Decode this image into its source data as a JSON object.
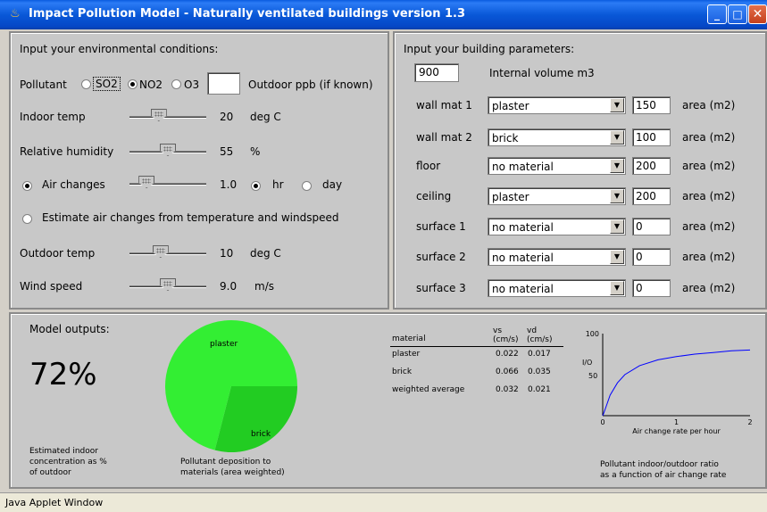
{
  "window": {
    "title": "Impact Pollution Model - Naturally ventilated buildings version 1.3",
    "minimize": "_",
    "maximize": "□",
    "close": "✕"
  },
  "env": {
    "heading": "Input your environmental conditions:",
    "pollutant_label": "Pollutant",
    "pollutants": [
      "SO2",
      "NO2",
      "O3"
    ],
    "selected_pollutant": "NO2",
    "outdoor_ppb_value": "",
    "outdoor_ppb_label": "Outdoor ppb (if known)",
    "indoor_temp": {
      "label": "Indoor temp",
      "value": "20",
      "unit": "deg C",
      "level": 0.35
    },
    "humidity": {
      "label": "Relative humidity",
      "value": "55",
      "unit": "%",
      "level": 0.5
    },
    "air_changes": {
      "label": "Air changes",
      "value": "1.0",
      "level": 0.15,
      "unit_hr": "hr",
      "unit_day": "day",
      "selected_unit": "hr"
    },
    "estimate_label": "Estimate air changes from temperature and windspeed",
    "mode": "air_changes",
    "outdoor_temp": {
      "label": "Outdoor temp",
      "value": "10",
      "unit": "deg C",
      "level": 0.38
    },
    "wind_speed": {
      "label": "Wind speed",
      "value": "9.0",
      "unit": "m/s",
      "level": 0.5
    }
  },
  "building": {
    "heading": "Input your building parameters:",
    "volume": "900",
    "volume_label": "Internal volume m3",
    "area_label": "area (m2)",
    "rows": [
      {
        "label": "wall mat 1",
        "material": "plaster",
        "area": "150"
      },
      {
        "label": "wall mat 2",
        "material": "brick",
        "area": "100"
      },
      {
        "label": "floor",
        "material": "no material",
        "area": "200"
      },
      {
        "label": "ceiling",
        "material": "plaster",
        "area": "200"
      },
      {
        "label": "surface 1",
        "material": "no material",
        "area": "0"
      },
      {
        "label": "surface 2",
        "material": "no material",
        "area": "0"
      },
      {
        "label": "surface 3",
        "material": "no material",
        "area": "0"
      }
    ]
  },
  "outputs": {
    "heading": "Model outputs:",
    "percent": "72%",
    "percent_caption_1": "Estimated indoor",
    "percent_caption_2": "concentration as %",
    "percent_caption_3": "of outdoor",
    "pie_caption_1": "Pollutant deposition to",
    "pie_caption_2": "materials (area weighted)",
    "pie_colors": {
      "plaster": "#33ee33",
      "brick": "#22cc22"
    },
    "table": {
      "headers": [
        "material",
        "vs\n(cm/s)",
        "vd\n(cm/s)"
      ],
      "rows": [
        [
          "plaster",
          "0.022",
          "0.017"
        ],
        [
          "brick",
          "0.066",
          "0.035"
        ],
        [
          "weighted average",
          "0.032",
          "0.021"
        ]
      ]
    },
    "graph_caption_1": "Pollutant indoor/outdoor ratio",
    "graph_caption_2": "as a function of air change rate"
  },
  "chart_data": [
    {
      "type": "pie",
      "labels": [
        "plaster",
        "brick"
      ],
      "values": [
        71,
        29
      ]
    },
    {
      "type": "line",
      "xlabel": "Air change rate per hour",
      "ylabel": "I/O",
      "xlim": [
        0,
        2
      ],
      "ylim": [
        0,
        100
      ],
      "x_ticks": [
        "0",
        "1",
        "2"
      ],
      "y_ticks": [
        "100",
        "50"
      ],
      "x": [
        0.01,
        0.05,
        0.1,
        0.2,
        0.3,
        0.5,
        0.75,
        1.0,
        1.25,
        1.5,
        1.75,
        2.0
      ],
      "y": [
        2,
        12,
        25,
        40,
        50,
        61,
        68,
        72,
        75,
        77,
        79,
        80
      ],
      "color": "#0000ff"
    }
  ],
  "status": "Java Applet Window"
}
